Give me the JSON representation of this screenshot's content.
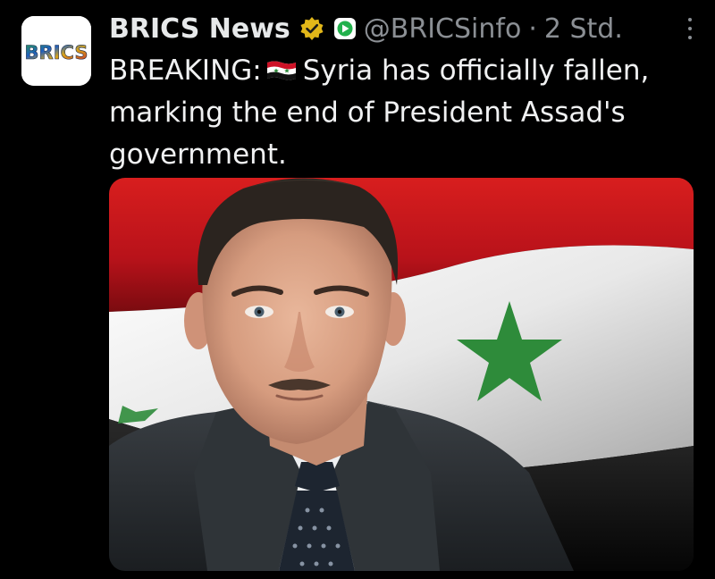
{
  "tweet": {
    "avatar": {
      "label": "BRICS",
      "icon": "brics-logo-icon"
    },
    "author": {
      "display_name": "BRICS News",
      "handle": "@BRICSinfo",
      "separator": "·",
      "time": "2 Std.",
      "verified_icon": "gold-verified-badge-icon",
      "affiliation_icon": "affiliation-badge-icon"
    },
    "text": {
      "prefix": "BREAKING:",
      "flag_icon": "syria-flag-emoji",
      "content": "Syria has officially fallen, marking the end of President Assad's government."
    },
    "media": {
      "type": "photo",
      "description_icon": "photo-portrait-with-syrian-flag"
    },
    "menu_icon": "more-options-icon"
  },
  "colors": {
    "background": "#000000",
    "text": "#e7e9ea",
    "muted": "#8b8f94",
    "gold_badge": "#e2b719",
    "flag_red": "#ce1126",
    "flag_green": "#2e8b3a"
  }
}
